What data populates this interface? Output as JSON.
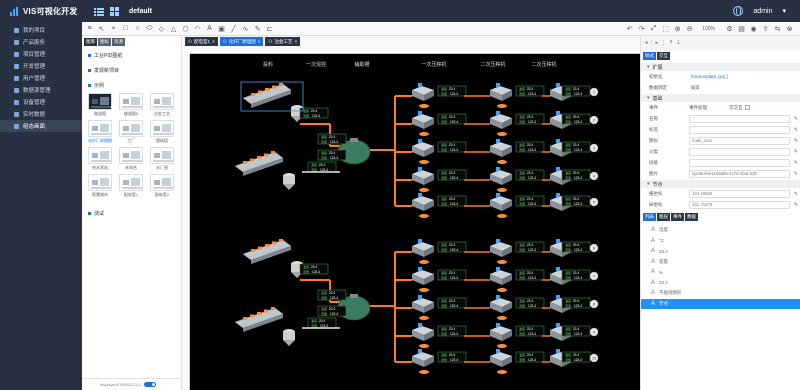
{
  "app": {
    "title": "VIS可视化开发",
    "project": "default",
    "user": "admin"
  },
  "sidebar": {
    "items": [
      {
        "label": "我的项目",
        "active": false
      },
      {
        "label": "产品服务",
        "active": false
      },
      {
        "label": "项目管理",
        "active": false
      },
      {
        "label": "开发管理",
        "active": false
      },
      {
        "label": "用户管理",
        "active": false
      },
      {
        "label": "数据源管理",
        "active": false
      },
      {
        "label": "设备管理",
        "active": false
      },
      {
        "label": "实时数据",
        "active": false
      },
      {
        "label": "组态画面",
        "active": true
      }
    ]
  },
  "toolbar": {
    "zoom": "100%"
  },
  "left_panel": {
    "tabs": [
      "图库",
      "图标",
      "资源"
    ],
    "sections": {
      "s1": "工业PID图纸",
      "s2": "发现新项目",
      "s3": "示例",
      "s4": "测试"
    },
    "examples": [
      {
        "label": "隧道图",
        "dark": true
      },
      {
        "label": "隧道图2",
        "dark": false
      },
      {
        "label": "冶金工艺",
        "dark": false
      },
      {
        "label": "化纤厂原理图",
        "dark": false,
        "highlight": true
      },
      {
        "label": "工厂",
        "dark": false
      },
      {
        "label": "脱硫塔",
        "dark": false
      },
      {
        "label": "给水泵站",
        "dark": false
      },
      {
        "label": "未命名",
        "dark": false
      },
      {
        "label": "水厂图",
        "dark": false
      },
      {
        "label": "智慧城市",
        "dark": false
      },
      {
        "label": "配电室1",
        "dark": false
      },
      {
        "label": "配电室2",
        "dark": false
      }
    ],
    "footer": "displays/6799002274-2"
  },
  "doc_tabs": [
    {
      "label": "配电室1",
      "active": false
    },
    {
      "label": "化纤厂原理图",
      "active": true
    },
    {
      "label": "冶金工艺",
      "active": false
    }
  ],
  "diagram": {
    "headers": [
      "投料",
      "一次混捏",
      "辅助槽",
      "一次压榨机",
      "二次压榨机",
      "二次压榨机"
    ],
    "labels": {
      "speed": "速度",
      "temp": "温度",
      "flow": "流量",
      "cap": "容量"
    },
    "temp_val": "23.4",
    "flow_val": "123.4",
    "ball_nums": [
      "1",
      "2",
      "3",
      "4",
      "5",
      "6",
      "7",
      "8",
      "9",
      "10"
    ],
    "colors": {
      "pipe_orange": "#ff7a1a",
      "pipe_white": "#e8e8e8",
      "bg": "#000000",
      "tank_green": "#3c7a62"
    }
  },
  "right_panel": {
    "top_tabs": [
      "样式",
      "交互"
    ],
    "sec_ext": "扩展",
    "rows_ext": [
      {
        "label": "初始化",
        "value": "function(data, gc){ }",
        "link": true
      },
      {
        "label": "数据绑定",
        "value": "编辑",
        "link": false
      }
    ],
    "sec_basic": "基础",
    "event": {
      "label": "事件",
      "value": "事件处理",
      "option": "可交互"
    },
    "rows_basic": [
      {
        "label": "名称",
        "value": ""
      },
      {
        "label": "标签",
        "value": ""
      },
      {
        "label": "图标",
        "value": "node_icon"
      },
      {
        "label": "父类",
        "value": ""
      },
      {
        "label": "层级",
        "value": ""
      },
      {
        "label": "图片",
        "value": "symbols/e1169ab6-1c7d-4fad-b35"
      }
    ],
    "sec_node": "节点",
    "rows_node": [
      {
        "label": "横坐标",
        "value": "444.15625"
      },
      {
        "label": "纵坐标",
        "value": "241.71679"
      }
    ],
    "list_tabs": [
      "列表",
      "图层",
      "事件",
      "数据"
    ],
    "list_items": [
      {
        "label": "温度",
        "selected": false
      },
      {
        "label": "°C",
        "selected": false
      },
      {
        "label": "23.4",
        "selected": false
      },
      {
        "label": "容量",
        "selected": false
      },
      {
        "label": "%",
        "selected": false
      },
      {
        "label": "23.4",
        "selected": false
      },
      {
        "label": "不规则图形",
        "selected": false
      },
      {
        "label": "节点",
        "selected": true
      }
    ]
  }
}
